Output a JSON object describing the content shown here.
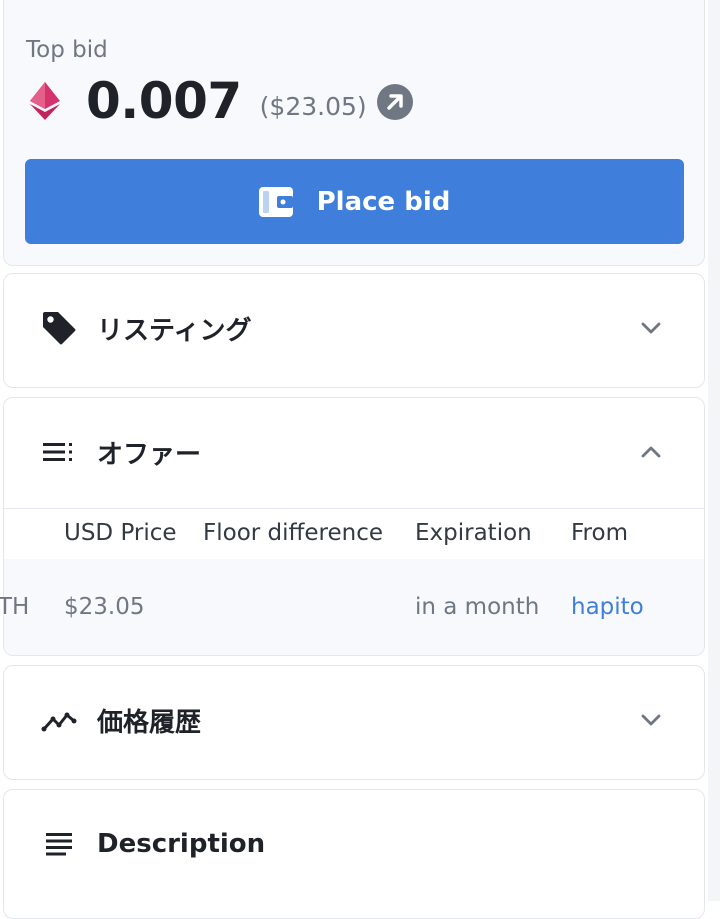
{
  "top_bid": {
    "label": "Top bid",
    "amount": "0.007",
    "usd": "($23.05)",
    "currency_icon": "ethereum-icon",
    "place_bid_label": "Place bid",
    "place_bid_icon": "wallet-icon"
  },
  "sections": {
    "listings": {
      "title": "リスティング",
      "icon": "tag-icon",
      "expanded": false
    },
    "offers": {
      "title": "オファー",
      "icon": "list-icon",
      "expanded": true,
      "columns": [
        "USD Price",
        "Floor difference",
        "Expiration",
        "From"
      ],
      "rows": [
        {
          "price_cut": "TH",
          "usd_price": "$23.05",
          "floor_difference": "",
          "expiration": "in a month",
          "from": "hapito"
        }
      ]
    },
    "price_history": {
      "title": "価格履歴",
      "icon": "trend-line-icon",
      "expanded": false
    },
    "description": {
      "title": "Description",
      "icon": "text-lines-icon"
    }
  },
  "colors": {
    "accent": "#3f7fdb",
    "eth": "#d6336c",
    "text": "#1f2329",
    "muted": "#6f7782"
  }
}
